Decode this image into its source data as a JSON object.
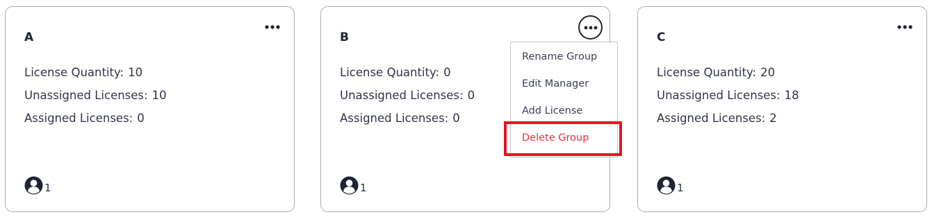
{
  "groups": [
    {
      "name": "A",
      "license_quantity_label": "License Quantity:",
      "license_quantity": "10",
      "unassigned_label": "Unassigned Licenses:",
      "unassigned": "10",
      "assigned_label": "Assigned Licenses:",
      "assigned": "0",
      "member_count": "1"
    },
    {
      "name": "B",
      "license_quantity_label": "License Quantity:",
      "license_quantity": "0",
      "unassigned_label": "Unassigned Licenses:",
      "unassigned": "0",
      "assigned_label": "Assigned Licenses:",
      "assigned": "0",
      "member_count": "1"
    },
    {
      "name": "C",
      "license_quantity_label": "License Quantity:",
      "license_quantity": "20",
      "unassigned_label": "Unassigned Licenses:",
      "unassigned": "18",
      "assigned_label": "Assigned Licenses:",
      "assigned": "2",
      "member_count": "1"
    }
  ],
  "menu": {
    "rename": "Rename Group",
    "edit_manager": "Edit Manager",
    "add_license": "Add License",
    "delete": "Delete Group"
  },
  "icons": {
    "more": "more-horizontal-icon",
    "user": "user-circle-icon"
  },
  "colors": {
    "text": "#2f3447",
    "title": "#1f2433",
    "border": "#a7abb4",
    "danger": "#e1303b",
    "highlight": "#e3161f"
  }
}
